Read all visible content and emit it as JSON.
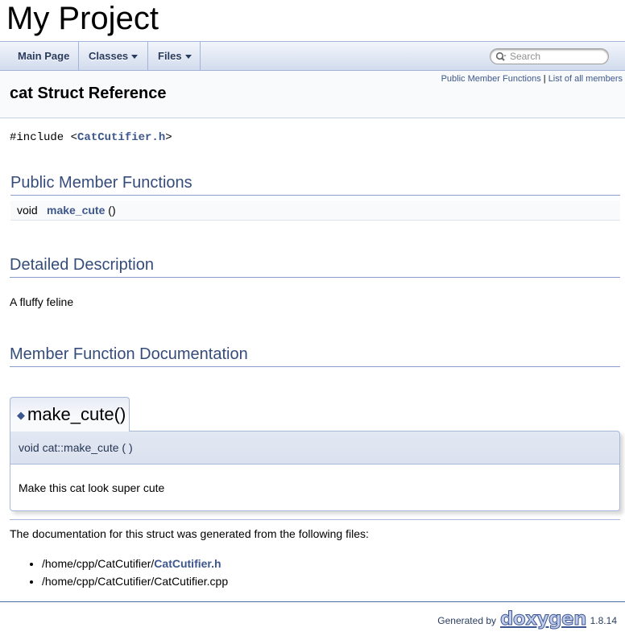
{
  "project": {
    "name": "My Project"
  },
  "nav": {
    "main_page": "Main Page",
    "classes": "Classes",
    "files": "Files",
    "search_placeholder": "Search"
  },
  "header": {
    "summary_public": "Public Member Functions",
    "summary_sep": " | ",
    "summary_all": "List of all members",
    "title": "cat Struct Reference"
  },
  "include": {
    "prefix": "#include <",
    "file": "CatCutifier.h",
    "suffix": ">"
  },
  "sections": {
    "public_member_functions": "Public Member Functions",
    "detailed_description": "Detailed Description",
    "member_function_documentation": "Member Function Documentation"
  },
  "members": [
    {
      "return_type": "void",
      "name": "make_cute",
      "args": " ()"
    }
  ],
  "description": "A fluffy feline",
  "memdoc": {
    "title": "make_cute()",
    "diamond": "◆",
    "prototype": "void cat::make_cute (  )",
    "doc": "Make this cat look super cute"
  },
  "files": {
    "intro": "The documentation for this struct was generated from the following files:",
    "items": [
      {
        "path": "/home/cpp/CatCutifier/",
        "link": "CatCutifier.h"
      },
      {
        "path": "/home/cpp/CatCutifier/CatCutifier.cpp",
        "link": ""
      }
    ]
  },
  "footer": {
    "generated_by": "Generated by",
    "logo": "doxygen",
    "version": "1.8.14"
  },
  "colors": {
    "link": "#3d578c",
    "heading": "#354c7b",
    "nav_text": "#283a5d"
  }
}
